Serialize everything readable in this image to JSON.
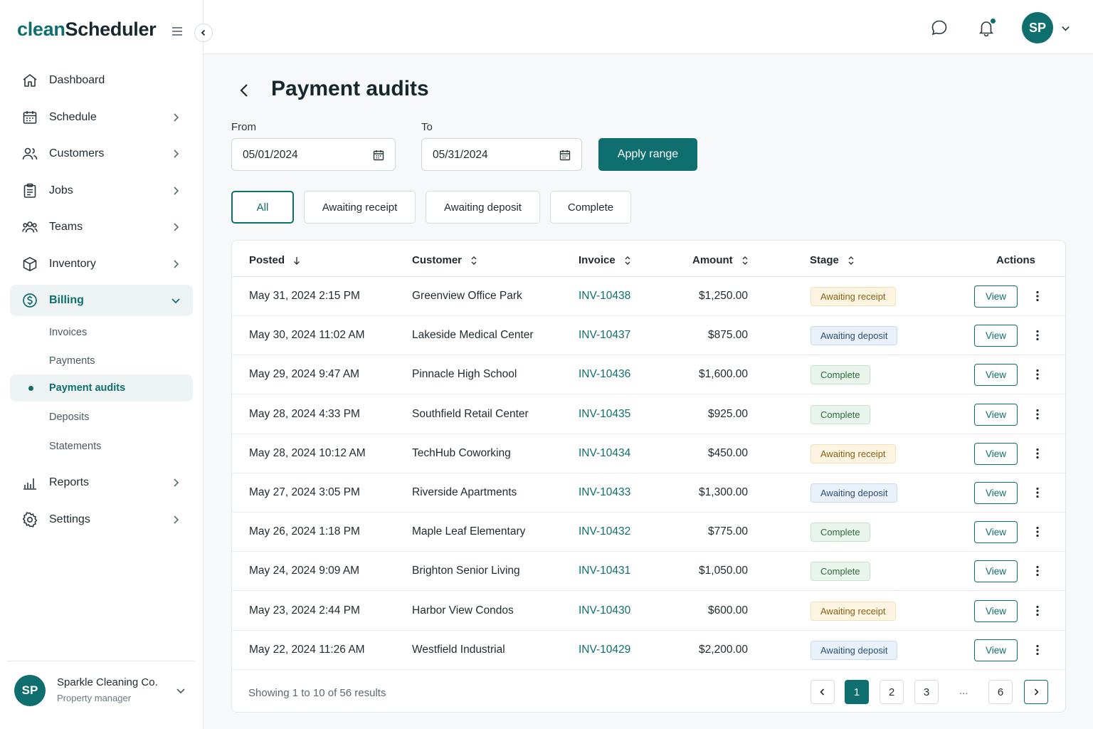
{
  "app": {
    "logo_part1": "clean",
    "logo_part2": "Scheduler"
  },
  "sidebar": {
    "items": [
      {
        "label": "Dashboard",
        "icon": "home-icon"
      },
      {
        "label": "Schedule",
        "icon": "calendar-icon"
      },
      {
        "label": "Customers",
        "icon": "customers-icon"
      },
      {
        "label": "Jobs",
        "icon": "clipboard-icon"
      },
      {
        "label": "Teams",
        "icon": "teams-icon"
      },
      {
        "label": "Inventory",
        "icon": "box-icon"
      },
      {
        "label": "Billing",
        "icon": "dollar-circle-icon"
      },
      {
        "label": "Reports",
        "icon": "bar-chart-icon"
      },
      {
        "label": "Settings",
        "icon": "gear-icon"
      }
    ],
    "billing_sub": [
      "Invoices",
      "Payments",
      "Payment audits",
      "Deposits",
      "Statements"
    ],
    "org": {
      "initials": "SP",
      "name": "Sparkle Cleaning Co.",
      "role": "Property manager"
    }
  },
  "topbar": {
    "user_initials": "SP"
  },
  "page": {
    "title": "Payment audits",
    "from_label": "From",
    "to_label": "To",
    "from_value": "05/01/2024",
    "to_value": "05/31/2024",
    "apply_label": "Apply range",
    "filters": [
      "All",
      "Awaiting receipt",
      "Awaiting deposit",
      "Complete"
    ]
  },
  "table": {
    "headers": {
      "posted": "Posted",
      "customer": "Customer",
      "invoice": "Invoice",
      "amount": "Amount",
      "stage": "Stage",
      "actions": "Actions"
    },
    "view_label": "View",
    "rows": [
      {
        "posted": "May 31, 2024 2:15 PM",
        "customer": "Greenview Office Park",
        "invoice": "INV-10438",
        "amount": "$1,250.00",
        "stage": "Awaiting receipt"
      },
      {
        "posted": "May 30, 2024 11:02 AM",
        "customer": "Lakeside Medical Center",
        "invoice": "INV-10437",
        "amount": "$875.00",
        "stage": "Awaiting deposit"
      },
      {
        "posted": "May 29, 2024 9:47 AM",
        "customer": "Pinnacle High School",
        "invoice": "INV-10436",
        "amount": "$1,600.00",
        "stage": "Complete"
      },
      {
        "posted": "May 28, 2024 4:33 PM",
        "customer": "Southfield Retail Center",
        "invoice": "INV-10435",
        "amount": "$925.00",
        "stage": "Complete"
      },
      {
        "posted": "May 28, 2024 10:12 AM",
        "customer": "TechHub Coworking",
        "invoice": "INV-10434",
        "amount": "$450.00",
        "stage": "Awaiting receipt"
      },
      {
        "posted": "May 27, 2024 3:05 PM",
        "customer": "Riverside Apartments",
        "invoice": "INV-10433",
        "amount": "$1,300.00",
        "stage": "Awaiting deposit"
      },
      {
        "posted": "May 26, 2024 1:18 PM",
        "customer": "Maple Leaf Elementary",
        "invoice": "INV-10432",
        "amount": "$775.00",
        "stage": "Complete"
      },
      {
        "posted": "May 24, 2024 9:09 AM",
        "customer": "Brighton Senior Living",
        "invoice": "INV-10431",
        "amount": "$1,050.00",
        "stage": "Complete"
      },
      {
        "posted": "May 23, 2024 2:44 PM",
        "customer": "Harbor View Condos",
        "invoice": "INV-10430",
        "amount": "$600.00",
        "stage": "Awaiting receipt"
      },
      {
        "posted": "May 22, 2024 11:26 AM",
        "customer": "Westfield Industrial",
        "invoice": "INV-10429",
        "amount": "$2,200.00",
        "stage": "Awaiting deposit"
      }
    ],
    "footer": "Showing 1 to 10 of 56 results",
    "pages": [
      "1",
      "2",
      "3",
      "...",
      "6"
    ]
  },
  "colors": {
    "accent": "#0f6e6e",
    "receipt": "#fdf4e2",
    "deposit": "#eaf1fb",
    "complete": "#e9f5ec"
  }
}
